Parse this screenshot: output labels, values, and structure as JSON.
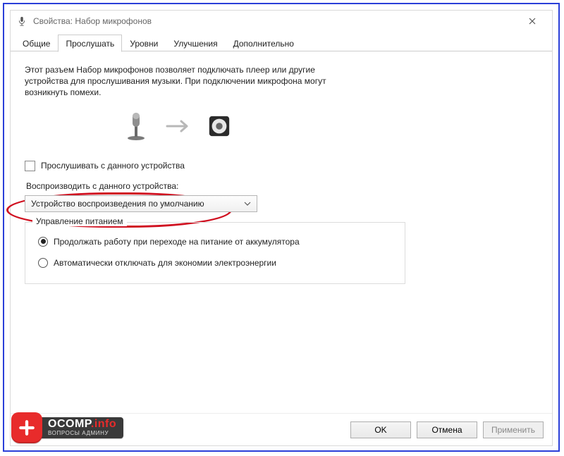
{
  "window": {
    "title": "Свойства: Набор микрофонов"
  },
  "tabs": [
    {
      "label": "Общие"
    },
    {
      "label": "Прослушать"
    },
    {
      "label": "Уровни"
    },
    {
      "label": "Улучшения"
    },
    {
      "label": "Дополнительно"
    }
  ],
  "active_tab_index": 1,
  "listen": {
    "description": "Этот разъем Набор микрофонов позволяет подключать плеер или другие устройства для прослушивания музыки. При подключении микрофона могут возникнуть помехи.",
    "checkbox_label": "Прослушивать с данного устройства",
    "checkbox_checked": false,
    "playthrough_label": "Воспроизводить с данного устройства:",
    "playthrough_selected": "Устройство воспроизведения по умолчанию"
  },
  "power": {
    "legend": "Управление питанием",
    "options": [
      "Продолжать работу при переходе на питание от аккумулятора",
      "Автоматически отключать для экономии электроэнергии"
    ],
    "selected_index": 0
  },
  "buttons": {
    "ok": "OK",
    "cancel": "Отмена",
    "apply": "Применить"
  },
  "logo": {
    "name": "OCOMP",
    "suffix": ".info",
    "tagline": "ВОПРОСЫ АДМИНУ"
  },
  "annotations": {
    "highlight": "red-oval-around-listen-checkbox"
  }
}
